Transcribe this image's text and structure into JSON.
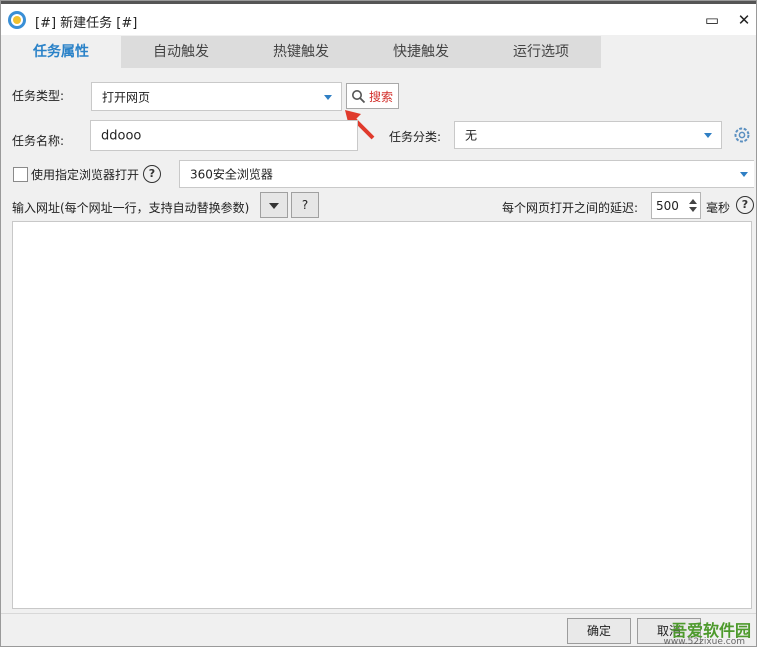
{
  "window": {
    "title": "[#] 新建任务 [#]",
    "maximize_glyph": "▭",
    "close_glyph": "✕"
  },
  "tabs": [
    {
      "label": "任务属性",
      "active": true
    },
    {
      "label": "自动触发",
      "active": false
    },
    {
      "label": "热键触发",
      "active": false
    },
    {
      "label": "快捷触发",
      "active": false
    },
    {
      "label": "运行选项",
      "active": false
    }
  ],
  "form": {
    "task_type_label": "任务类型:",
    "task_type_value": "打开网页",
    "search_label": "搜索",
    "task_name_label": "任务名称:",
    "task_name_value": "ddooo",
    "category_label": "任务分类:",
    "category_value": "无",
    "browser_checkbox_label": "使用指定浏览器打开",
    "browser_checked": false,
    "browser_value": "360安全浏览器",
    "url_label": "输入网址(每个网址一行，支持自动替换参数)",
    "help_btn_label": "?",
    "delay_label": "每个网页打开之间的延迟:",
    "delay_value": "500",
    "delay_unit": "毫秒",
    "url_text": ""
  },
  "footer": {
    "ok_label": "确定",
    "cancel_label": "取消"
  },
  "watermark": {
    "brand": "吾爱软件园",
    "url": "www.52zixue.com"
  },
  "colors": {
    "accent": "#2a82c8",
    "search_red": "#d2302c",
    "arrow_red": "#e03a2c"
  }
}
